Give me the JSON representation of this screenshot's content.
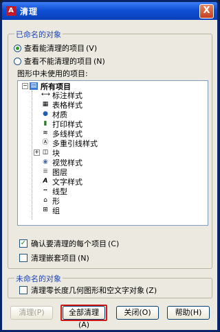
{
  "window": {
    "title": "清理",
    "close_label": "X"
  },
  "named_group": {
    "legend": "已命名的对象",
    "radio_can_purge": "查看能清理的项目",
    "radio_can_purge_key": "(V)",
    "radio_cannot_purge": "查看不能清理的项目",
    "radio_cannot_purge_key": "(N)",
    "tree_label": "图形中未使用的项目:",
    "tree": {
      "root": "所有项目",
      "items": [
        "标注样式",
        "表格样式",
        "材质",
        "打印样式",
        "多线样式",
        "多重引线样式",
        "块",
        "视觉样式",
        "图层",
        "文字样式",
        "线型",
        "形",
        "组"
      ]
    },
    "confirm_each": "确认要清理的每个项目",
    "confirm_each_key": "(C)",
    "purge_nested": "清理嵌套项目",
    "purge_nested_key": "(N)"
  },
  "unnamed_group": {
    "legend": "未命名的对象",
    "purge_zero": "清理零长度几何图形和空文字对象",
    "purge_zero_key": "(Z)"
  },
  "buttons": {
    "purge": "清理(P)",
    "purge_all": "全部清理(A)",
    "close": "关闭(O)",
    "help": "帮助(H)"
  },
  "colors": {
    "title_bar": "#0f4fd6",
    "highlight": "#d11616",
    "legend_text": "#1c44b8"
  }
}
